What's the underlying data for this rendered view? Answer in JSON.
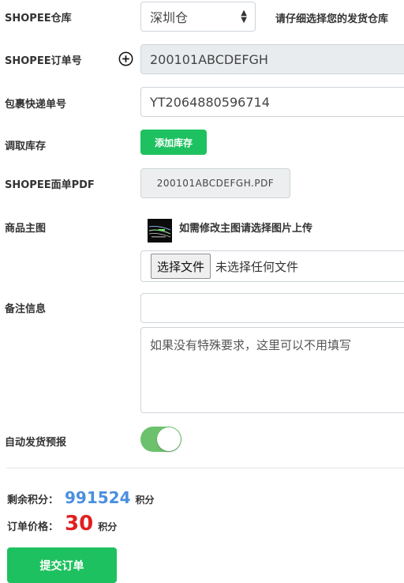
{
  "warehouse": {
    "label": "SHOPEE仓库",
    "selected": "深圳仓",
    "hint": "请仔细选择您的发货仓库"
  },
  "order_no": {
    "label": "SHOPEE订单号",
    "value": "200101ABCDEFGH"
  },
  "tracking": {
    "label": "包裹快递单号",
    "value": "YT2064880596714"
  },
  "inventory": {
    "label": "调取库存",
    "button": "添加库存"
  },
  "pdf": {
    "label": "SHOPEE面单PDF",
    "file": "200101ABCDEFGH.PDF"
  },
  "main_image": {
    "label": "商品主图",
    "hint": "如需修改主图请选择图片上传",
    "choose_button": "选择文件",
    "status": "未选择任何文件"
  },
  "remarks": {
    "label": "备注信息",
    "input_value": "",
    "textarea_placeholder": "如果没有特殊要求，这里可以不用填写"
  },
  "auto_report": {
    "label": "自动发货预报",
    "enabled": true
  },
  "points": {
    "label": "剩余积分：",
    "value": "991524",
    "unit": "积分"
  },
  "price": {
    "label": "订单价格：",
    "value": "30",
    "unit": "积分"
  },
  "submit": {
    "label": "提交订单"
  },
  "colors": {
    "primary_green": "#1ec15f",
    "toggle_green": "#6cc26c",
    "points_blue": "#4a8fe0",
    "price_red": "#e02020"
  }
}
